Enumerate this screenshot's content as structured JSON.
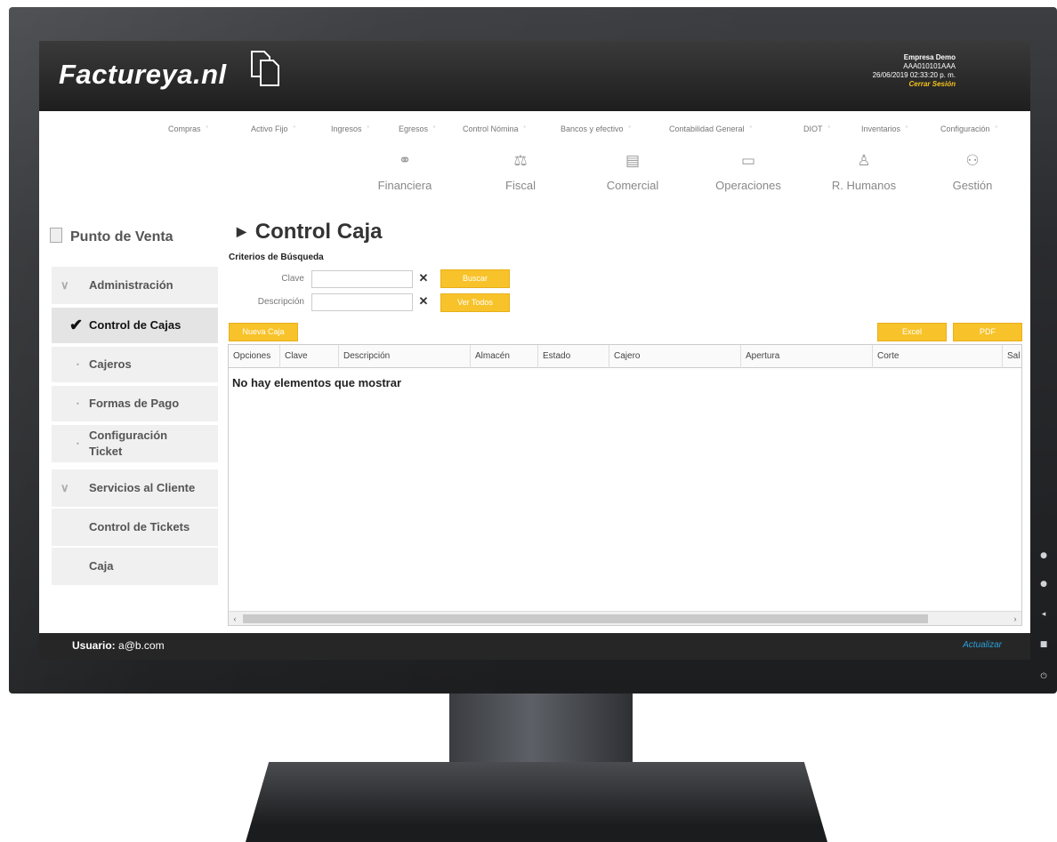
{
  "app": {
    "brand": "Factureya.nl"
  },
  "company": {
    "name": "Empresa Demo",
    "rfc": "AAA010101AAA",
    "datetime": "26/06/2019 02:33:20 p. m.",
    "logout": "Cerrar Sesión"
  },
  "menu": [
    "Compras",
    "Activo Fijo",
    "Ingresos",
    "Egresos",
    "Control Nómina",
    "Bancos y efectivo",
    "Contabilidad General",
    "DIOT",
    "Inventarios",
    "Configuración"
  ],
  "modules": [
    {
      "label": "Financiera",
      "icon": "link-icon"
    },
    {
      "label": "Fiscal",
      "icon": "scale-icon"
    },
    {
      "label": "Comercial",
      "icon": "building-icon"
    },
    {
      "label": "Operaciones",
      "icon": "monitor-icon"
    },
    {
      "label": "R. Humanos",
      "icon": "person-icon"
    },
    {
      "label": "Gestión",
      "icon": "org-chart-icon"
    }
  ],
  "sidebar": {
    "title": "Punto de Venta",
    "sections": [
      {
        "label": "Administración"
      },
      {
        "label": "Servicios al Cliente"
      }
    ],
    "items": [
      {
        "label": "Control de Cajas"
      },
      {
        "label": "Cajeros"
      },
      {
        "label": "Formas de Pago"
      },
      {
        "label": "Configuración Ticket"
      },
      {
        "label": "Control de Tickets"
      },
      {
        "label": "Caja"
      }
    ]
  },
  "main": {
    "title": "Control Caja",
    "criteria_title": "Criterios de Búsqueda",
    "clave_label": "Clave",
    "clave_value": "",
    "descripcion_label": "Descripción",
    "descripcion_value": "",
    "buscar": "Buscar",
    "ver_todos": "Ver Todos",
    "nueva_caja": "Nueva Caja",
    "excel": "Excel",
    "pdf": "PDF",
    "columns": [
      "Opciones",
      "Clave",
      "Descripción",
      "Almacén",
      "Estado",
      "Cajero",
      "Apertura",
      "Corte",
      "Sal"
    ],
    "empty_message": "No hay elementos que mostrar"
  },
  "status": {
    "user_label": "Usuario:",
    "user_value": "a@b.com",
    "refresh": "Actualizar"
  },
  "colors": {
    "accent_yellow": "#f8c32a",
    "header_dark": "#262626",
    "link_blue": "#2b9fd8"
  }
}
